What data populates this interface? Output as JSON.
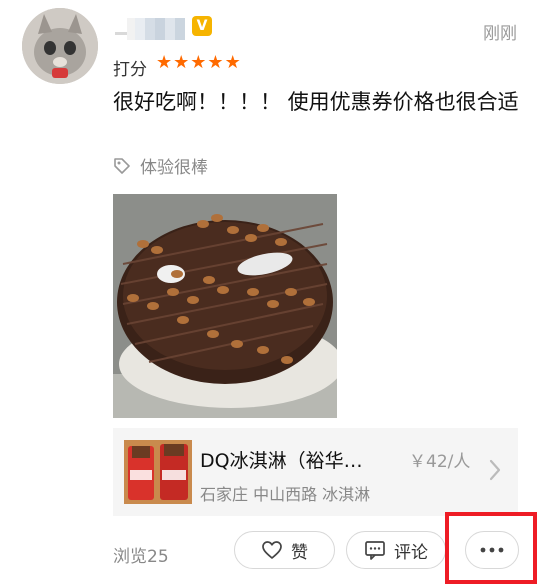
{
  "header": {
    "time": "刚刚",
    "vip_badge": "V"
  },
  "rating": {
    "label": "打分",
    "stars": 5,
    "star_char": "★"
  },
  "review": {
    "text": "很好吃啊！！！！ 使用优惠券价格也很合适",
    "tag": "体验很棒"
  },
  "shop": {
    "name": "DQ冰淇淋（裕华…",
    "price": "￥42/人",
    "location": "石家庄 中山西路 冰淇淋"
  },
  "footer": {
    "views": "浏览25",
    "like_label": "赞",
    "comment_label": "评论"
  },
  "colors": {
    "star": "#ff6a00",
    "highlight": "#ee1c25",
    "vip": "#f6b400"
  }
}
